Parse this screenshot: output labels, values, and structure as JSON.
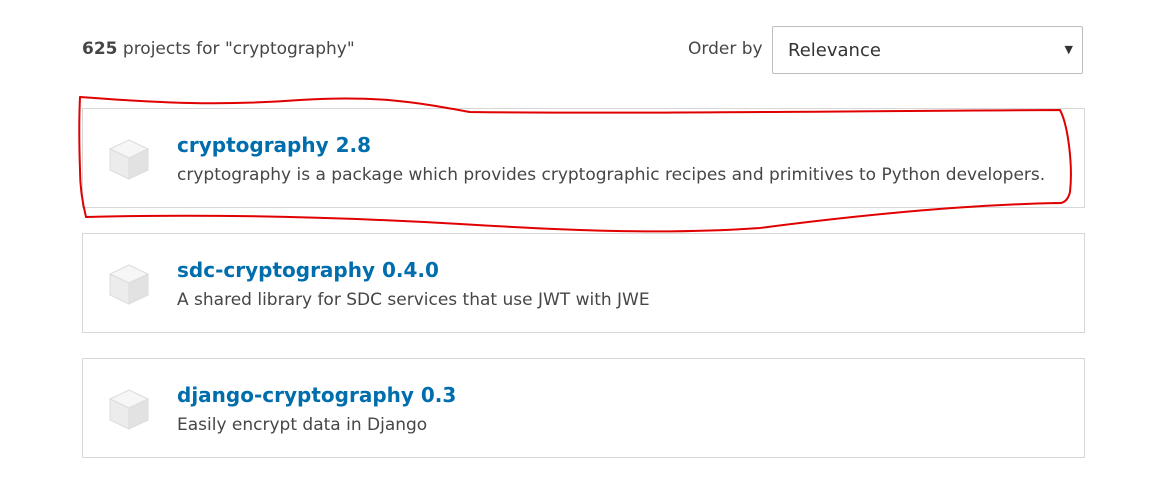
{
  "results": {
    "count": "625",
    "count_suffix": " projects for \"cryptography\"",
    "order_label": "Order by",
    "order_selected": "Relevance",
    "caret_icon": "caret-down-icon"
  },
  "packages": [
    {
      "title": "cryptography 2.8",
      "description": "cryptography is a package which provides cryptographic recipes and primitives to Python developers.",
      "icon": "package-cube-icon"
    },
    {
      "title": "sdc-cryptography 0.4.0",
      "description": "A shared library for SDC services that use JWT with JWE",
      "icon": "package-cube-icon"
    },
    {
      "title": "django-cryptography 0.3",
      "description": "Easily encrypt data in Django",
      "icon": "package-cube-icon"
    }
  ],
  "colors": {
    "link": "#006dad",
    "text": "#464646",
    "border": "#d7d7d7",
    "annotation": "#e00000"
  }
}
